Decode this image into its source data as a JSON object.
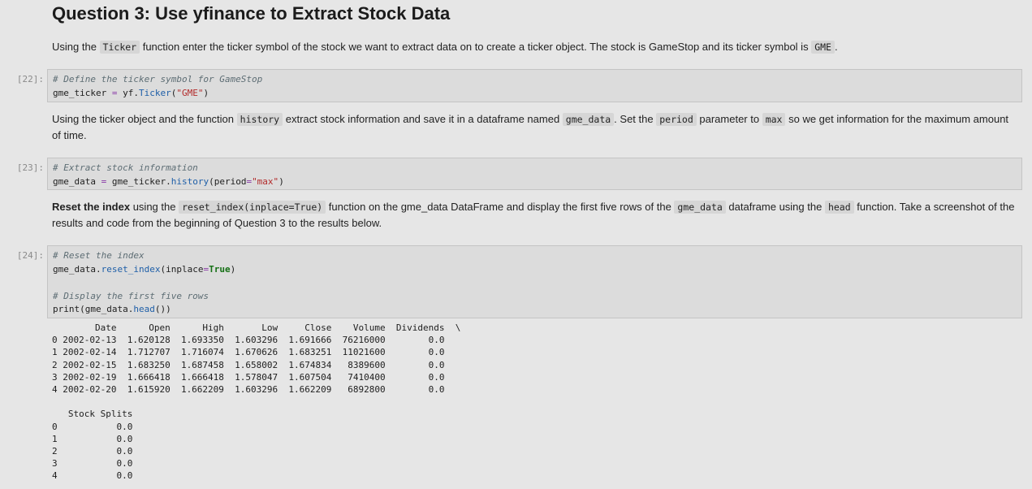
{
  "heading": "Question 3: Use yfinance to Extract Stock Data",
  "md1": {
    "t1": "Using the ",
    "code1": "Ticker",
    "t2": " function enter the ticker symbol of the stock we want to extract data on to create a ticker object. The stock is GameStop and its ticker symbol is ",
    "code2": "GME",
    "t3": "."
  },
  "cell22": {
    "prompt": "[22]:",
    "comment": "# Define the ticker symbol for GameStop",
    "l2a": "gme_ticker ",
    "l2op": "=",
    "l2b": " yf.",
    "l2fn": "Ticker",
    "l2c": "(",
    "l2str": "\"GME\"",
    "l2d": ")"
  },
  "md2": {
    "t1": "Using the ticker object and the function ",
    "code1": "history",
    "t2": " extract stock information and save it in a dataframe named ",
    "code2": "gme_data",
    "t3": ". Set the ",
    "code3": "period",
    "t4": " parameter to ",
    "code4": "max",
    "t5": " so we get information for the maximum amount of time."
  },
  "cell23": {
    "prompt": "[23]:",
    "comment": "# Extract stock information",
    "l2a": "gme_data ",
    "l2op": "=",
    "l2b": " gme_ticker.",
    "l2fn": "history",
    "l2c": "(period",
    "l2op2": "=",
    "l2str": "\"max\"",
    "l2d": ")"
  },
  "md3": {
    "bold": "Reset the index",
    "t1": " using the ",
    "code1": "reset_index(inplace=True)",
    "t2": " function on the gme_data DataFrame and display the first five rows of the ",
    "code2": "gme_data",
    "t3": " dataframe using the ",
    "code3": "head",
    "t4": " function. Take a screenshot of the results and code from the beginning of Question 3 to the results below."
  },
  "cell24": {
    "prompt": "[24]:",
    "comment1": "# Reset the index",
    "l2a": "gme_data.",
    "l2fn": "reset_index",
    "l2b": "(inplace",
    "l2op": "=",
    "l2kw": "True",
    "l2c": ")",
    "comment2": "# Display the first five rows",
    "l5a": "print(gme_data.",
    "l5fn": "head",
    "l5b": "())"
  },
  "output": "        Date      Open      High       Low     Close    Volume  Dividends  \\\n0 2002-02-13  1.620128  1.693350  1.603296  1.691666  76216000        0.0   \n1 2002-02-14  1.712707  1.716074  1.670626  1.683251  11021600        0.0   \n2 2002-02-15  1.683250  1.687458  1.658002  1.674834   8389600        0.0   \n3 2002-02-19  1.666418  1.666418  1.578047  1.607504   7410400        0.0   \n4 2002-02-20  1.615920  1.662209  1.603296  1.662209   6892800        0.0   \n\n   Stock Splits  \n0           0.0  \n1           0.0  \n2           0.0  \n3           0.0  \n4           0.0  "
}
